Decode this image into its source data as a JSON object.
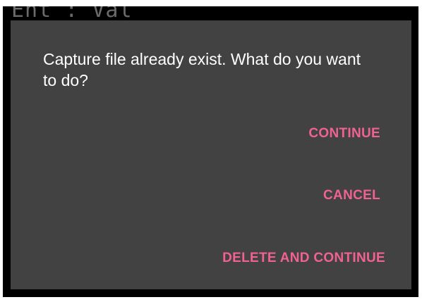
{
  "background": {
    "partial_text": "Ent : Val"
  },
  "dialog": {
    "message": "Capture file already exist. What do you want to do?",
    "actions": {
      "continue_label": "CONTINUE",
      "cancel_label": "CANCEL",
      "delete_continue_label": "DELETE AND CONTINUE"
    }
  },
  "colors": {
    "dialog_background": "#424242",
    "accent": "#f06292",
    "message_text": "#ffffff",
    "screen_background": "#000000"
  }
}
